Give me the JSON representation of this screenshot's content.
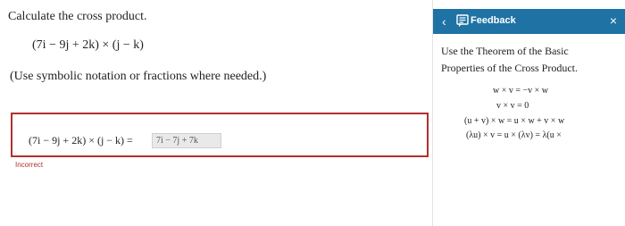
{
  "question": {
    "instruction": "Calculate the cross product.",
    "expression": "(7i − 9j + 2k) × (j − k)",
    "note": "(Use symbolic notation or fractions where needed.)"
  },
  "answer": {
    "lhs": "(7i − 9j + 2k) × (j − k) =",
    "value": "7i − 7j + 7k",
    "status": "Incorrect"
  },
  "feedback": {
    "back_symbol": "‹",
    "title": "Feedback",
    "close_symbol": "×",
    "hint": "Use the Theorem of the Basic Properties of the Cross Product.",
    "formulas": [
      "w × v = −v × w",
      "v × v = 0",
      "(u + v) × w = u × w + v × w",
      "(λu) × v = u × (λv) = λ(u ×"
    ]
  },
  "colors": {
    "header_blue": "#1e73a4",
    "error_red": "#b32f2f"
  },
  "icons": {
    "feedback": "feedback-icon",
    "back": "chevron-left-icon",
    "close": "close-icon"
  }
}
